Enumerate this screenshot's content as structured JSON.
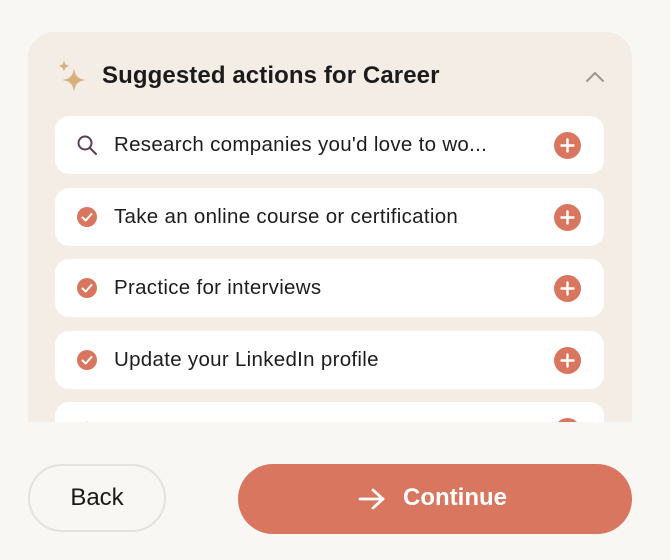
{
  "panel": {
    "title": "Suggested actions for Career",
    "items": [
      {
        "icon": "search-icon",
        "label": "Research companies you'd love to wo..."
      },
      {
        "icon": "check-circle-icon",
        "label": "Take an online course or certification"
      },
      {
        "icon": "check-circle-icon",
        "label": "Practice for interviews"
      },
      {
        "icon": "check-circle-icon",
        "label": "Update your LinkedIn profile"
      },
      {
        "icon": "star-icon",
        "label": ""
      }
    ]
  },
  "footer": {
    "back_label": "Back",
    "continue_label": "Continue"
  },
  "colors": {
    "accent": "#d97660",
    "panel_bg": "#f3ede6",
    "page_bg": "#f9f7f4",
    "sparkle": "#d8b07e",
    "search_icon": "#5b3f5a"
  }
}
